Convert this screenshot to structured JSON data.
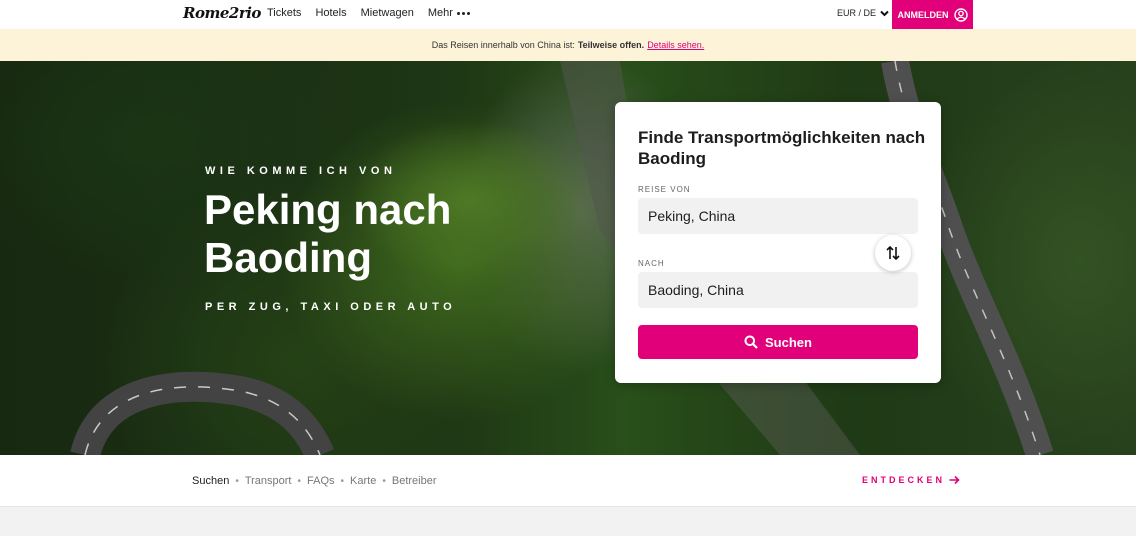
{
  "nav": {
    "logo": "Rome2rio",
    "links": [
      "Tickets",
      "Hotels",
      "Mietwagen"
    ],
    "more": "Mehr",
    "currency": "EUR / DE",
    "login": "ANMELDEN"
  },
  "banner": {
    "text": "Das Reisen innerhalb von China ist:",
    "status": "Teilweise offen.",
    "link": "Details sehen."
  },
  "hero": {
    "kicker": "WIE KOMME ICH VON",
    "title": "Peking nach Baoding",
    "subtitle": "PER ZUG, TAXI ODER AUTO"
  },
  "search": {
    "heading": "Finde Transportmöglichkeiten nach Baoding",
    "from_label": "REISE VON",
    "from_value": "Peking, China",
    "to_label": "NACH",
    "to_value": "Baoding, China",
    "button": "Suchen"
  },
  "subnav": {
    "items": [
      "Suchen",
      "Transport",
      "FAQs",
      "Karte",
      "Betreiber"
    ],
    "explore": "ENTDECKEN"
  },
  "colors": {
    "accent": "#e2007a",
    "banner_bg": "#fdf3d8"
  }
}
